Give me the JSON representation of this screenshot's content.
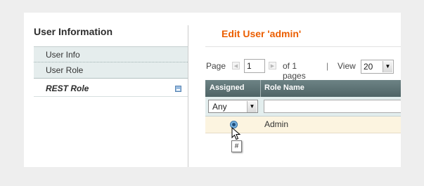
{
  "sidebar": {
    "title": "User Information",
    "items": [
      {
        "label": "User Info"
      },
      {
        "label": "User Role"
      },
      {
        "label": "REST Role"
      }
    ]
  },
  "main": {
    "heading": "Edit User 'admin'"
  },
  "pager": {
    "page_label": "Page",
    "page_value": "1",
    "of_pages": "of 1 pages",
    "separator": "|",
    "view_label": "View",
    "view_value": "20"
  },
  "grid": {
    "columns": [
      "Assigned",
      "Role Name"
    ],
    "filter_assigned": "Any",
    "rows": [
      {
        "role_name": "Admin",
        "assigned": true
      }
    ],
    "tooltip": "#"
  },
  "colors": {
    "heading": "#eb5e00",
    "grid_header": "#5d7274",
    "row_highlight": "#fcf4e0"
  }
}
